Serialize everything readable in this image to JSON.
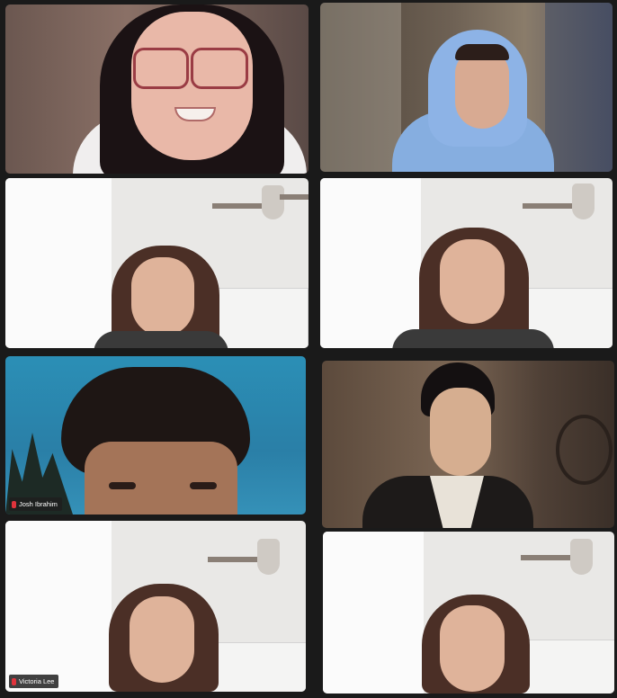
{
  "participants": [
    {
      "name": "",
      "muted": false
    },
    {
      "name": "",
      "muted": false
    },
    {
      "name": "",
      "muted": false
    },
    {
      "name": "",
      "muted": false
    },
    {
      "name": "Josh Ibrahim",
      "muted": true
    },
    {
      "name": "",
      "muted": false
    },
    {
      "name": "Victoria Lee",
      "muted": true
    },
    {
      "name": "",
      "muted": false
    }
  ]
}
